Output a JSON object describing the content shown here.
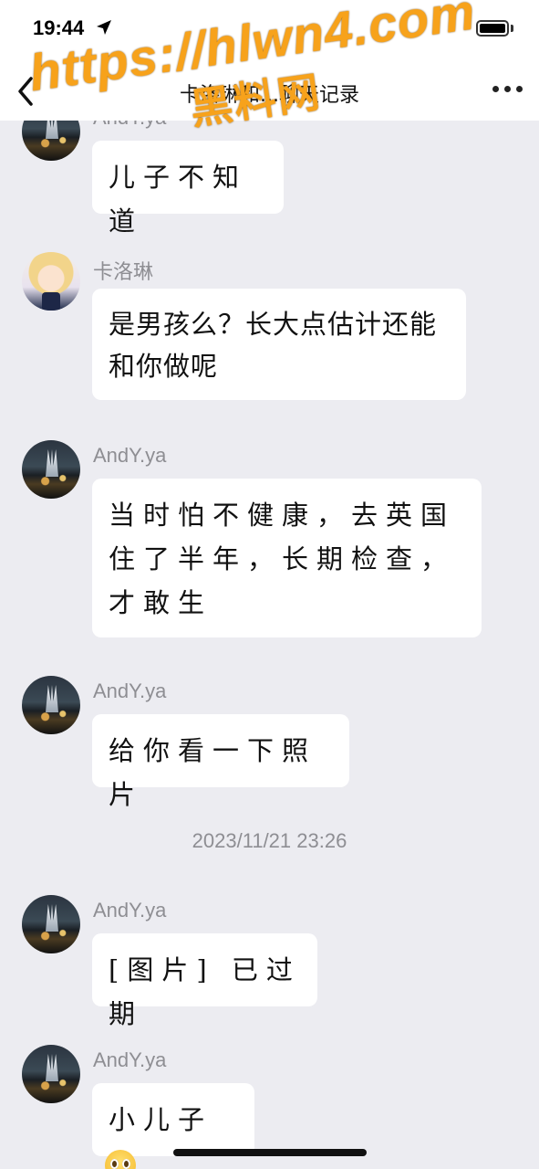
{
  "status_bar": {
    "time": "19:44"
  },
  "nav": {
    "title": "卡洛琳和...聊天记录"
  },
  "watermark": {
    "url": "https://hlwn4.com",
    "site": "黑料网"
  },
  "messages": [
    {
      "sender": "AndY.ya",
      "text": "儿子不知道",
      "avatar": "city"
    },
    {
      "sender": "卡洛琳",
      "text": "是男孩么？长大点估计还能和你做呢",
      "avatar": "anime"
    },
    {
      "sender": "AndY.ya",
      "text": "当时怕不健康，去英国住了半年，长期检查，才敢生",
      "avatar": "city"
    },
    {
      "sender": "AndY.ya",
      "text": "给你看一下照片",
      "avatar": "city"
    },
    {
      "timestamp": "2023/11/21 23:26"
    },
    {
      "sender": "AndY.ya",
      "text": "[图片] 已过期",
      "avatar": "city"
    },
    {
      "sender": "AndY.ya",
      "text": "小儿子",
      "emoji": "blushing-face-emoji",
      "avatar": "city"
    }
  ],
  "colors": {
    "background": "#ececf1",
    "bubble": "#ffffff",
    "sender": "#8e8e93",
    "watermark": "#f7a21b"
  }
}
